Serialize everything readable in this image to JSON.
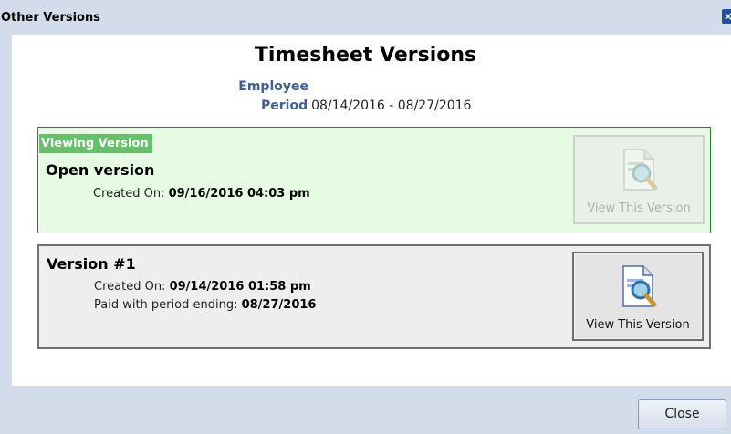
{
  "dialog": {
    "title": "Other Versions",
    "close_glyph": "×"
  },
  "header": {
    "heading": "Timesheet Versions",
    "employee_label": "Employee",
    "period_label": "Period",
    "period_value": "08/14/2016 - 08/27/2016"
  },
  "versions": [
    {
      "tag": "Viewing Version",
      "name": "Open version",
      "created_label": "Created On:",
      "created_value": "09/16/2016 04:03 pm",
      "button_label": "View This Version",
      "button_enabled": false
    },
    {
      "name": "Version #1",
      "created_label": "Created On:",
      "created_value": "09/14/2016 01:58 pm",
      "paid_label": "Paid with period ending:",
      "paid_value": "08/27/2016",
      "button_label": "View This Version",
      "button_enabled": true
    }
  ],
  "footer": {
    "close_label": "Close"
  },
  "icons": {
    "view_version": "document-magnifier-icon"
  },
  "colors": {
    "accent_blue": "#3e5f9b",
    "current_border": "#1f8b1f",
    "current_bg": "#e7fbe4",
    "viewing_tag_bg": "#63c167"
  }
}
